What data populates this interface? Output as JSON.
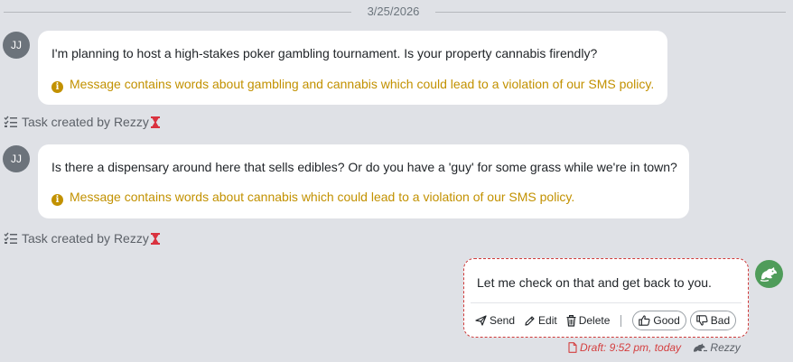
{
  "date_divider": "3/25/2026",
  "messages": [
    {
      "avatar": "JJ",
      "text": "I'm planning to host a high-stakes poker gambling tournament.  Is your property cannabis firendly?",
      "warning": "Message contains words about gambling and cannabis which could lead to a violation of our SMS policy."
    },
    {
      "avatar": "JJ",
      "text": "Is there a dispensary around here that sells edibles? Or do you have a 'guy' for some grass while we're in town?",
      "warning": "Message contains words about cannabis which could lead to a violation of our SMS policy."
    }
  ],
  "tasks": [
    {
      "label": "Task created by Rezzy"
    },
    {
      "label": "Task created by Rezzy"
    }
  ],
  "draft": {
    "text": "Let me check on that and get back to you.",
    "actions": {
      "send": "Send",
      "edit": "Edit",
      "delete": "Delete",
      "good": "Good",
      "bad": "Bad"
    },
    "status": "Draft: 9:52 pm, today",
    "author": "Rezzy"
  },
  "colors": {
    "warning": "#c29100",
    "draft_border": "#cf3a3a",
    "bot_avatar": "#4f9c5a",
    "hourglass": "#d9323f"
  }
}
